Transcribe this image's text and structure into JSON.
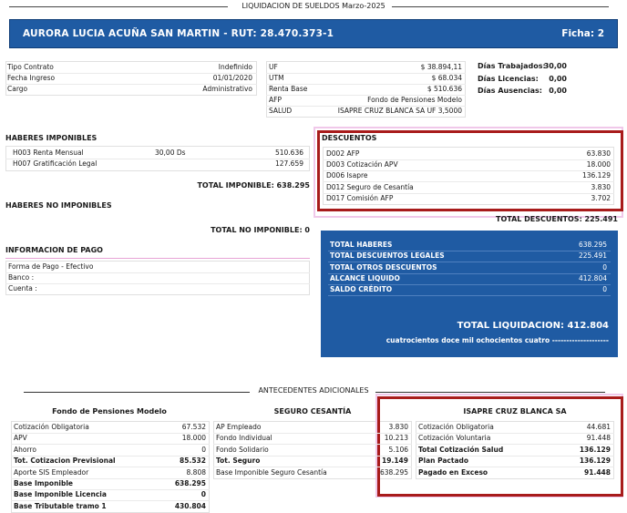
{
  "header": {
    "title": "LIQUIDACION DE SUELDOS Marzo-2025",
    "employee": "AURORA LUCIA ACUÑA SAN MARTIN - RUT: 28.470.373-1",
    "ficha": "Ficha: 2"
  },
  "info_left": [
    {
      "label": "Tipo Contrato",
      "value": "Indefinido"
    },
    {
      "label": "Fecha Ingreso",
      "value": "01/01/2020"
    },
    {
      "label": "Cargo",
      "value": "Administrativo"
    }
  ],
  "info_mid": [
    {
      "label": "UF",
      "value": "$ 38.894,11"
    },
    {
      "label": "UTM",
      "value": "$ 68.034"
    },
    {
      "label": "Renta Base",
      "value": "$ 510.636"
    },
    {
      "label": "AFP",
      "value": "Fondo de Pensiones Modelo"
    },
    {
      "label": "SALUD",
      "value": "ISAPRE CRUZ BLANCA SA UF 3,5000"
    }
  ],
  "days": [
    {
      "label": "Días Trabajados:",
      "value": "30,00"
    },
    {
      "label": "Días Licencias:",
      "value": "0,00"
    },
    {
      "label": "Días Ausencias:",
      "value": "0,00"
    }
  ],
  "haberes_imponibles": {
    "title": "HABERES IMPONIBLES",
    "items": [
      {
        "code": "H003 Renta Mensual",
        "qty": "30,00 Ds",
        "value": "510.636"
      },
      {
        "code": "H007 Gratificación Legal",
        "qty": "",
        "value": "127.659"
      }
    ],
    "total": "TOTAL IMPONIBLE: 638.295"
  },
  "haberes_no_imponibles": {
    "title": "HABERES NO IMPONIBLES",
    "total": "TOTAL NO IMPONIBLE: 0"
  },
  "pago": {
    "title": "INFORMACION DE PAGO",
    "rows": [
      "Forma de Pago - Efectivo",
      "Banco :",
      "Cuenta :"
    ]
  },
  "descuentos": {
    "title": "DESCUENTOS",
    "items": [
      {
        "label": "D002 AFP",
        "value": "63.830"
      },
      {
        "label": "D003 Cotización APV",
        "value": "18.000"
      },
      {
        "label": "D006 Isapre",
        "value": "136.129"
      },
      {
        "label": "D012 Seguro de Cesantía",
        "value": "3.830"
      },
      {
        "label": "D017 Comisión AFP",
        "value": "3.702"
      }
    ],
    "total": "TOTAL DESCUENTOS: 225.491"
  },
  "summary": {
    "rows": [
      {
        "label": "TOTAL HABERES",
        "value": "638.295"
      },
      {
        "label": "TOTAL DESCUENTOS LEGALES",
        "value": "225.491"
      },
      {
        "label": "TOTAL OTROS DESCUENTOS",
        "value": "0"
      },
      {
        "label": "ALCANCE LIQUIDO",
        "value": "412.804"
      },
      {
        "label": "SALDO CRÉDITO",
        "value": "0"
      }
    ],
    "total": "TOTAL LIQUIDACION: 412.804",
    "words": "cuatrocientos doce mil ochocientos cuatro --------------------"
  },
  "antecedentes": {
    "title": "ANTECEDENTES ADICIONALES",
    "afp": {
      "title": "Fondo de Pensiones Modelo",
      "rows": [
        {
          "label": "Cotización Obligatoria",
          "value": "67.532",
          "bold": false
        },
        {
          "label": "APV",
          "value": "18.000",
          "bold": false
        },
        {
          "label": "Ahorro",
          "value": "0",
          "bold": false
        },
        {
          "label": "Tot. Cotizacion Previsional",
          "value": "85.532",
          "bold": true
        },
        {
          "label": "Aporte SIS Empleador",
          "value": "8.808",
          "bold": false
        },
        {
          "label": "Base Imponible",
          "value": "638.295",
          "bold": true
        },
        {
          "label": "Base Imponible Licencia",
          "value": "0",
          "bold": true
        },
        {
          "label": "Base Tributable tramo 1",
          "value": "430.804",
          "bold": true
        }
      ]
    },
    "cesantia": {
      "title": "SEGURO CESANTÍA",
      "rows": [
        {
          "label": "AP Empleado",
          "value": "3.830",
          "bold": false
        },
        {
          "label": "Fondo Individual",
          "value": "10.213",
          "bold": false
        },
        {
          "label": "Fondo Solidario",
          "value": "5.106",
          "bold": false
        },
        {
          "label": "Tot. Seguro",
          "value": "19.149",
          "bold": true
        },
        {
          "label": "Base Imponible Seguro Cesantía",
          "value": "638.295",
          "bold": false
        }
      ]
    },
    "isapre": {
      "title": "ISAPRE CRUZ BLANCA SA",
      "rows": [
        {
          "label": "Cotización Obligatoria",
          "value": "44.681",
          "bold": false
        },
        {
          "label": "Cotización Voluntaria",
          "value": "91.448",
          "bold": false
        },
        {
          "label": "Total Cotización Salud",
          "value": "136.129",
          "bold": true
        },
        {
          "label": "Plan Pactado",
          "value": "136.129",
          "bold": true
        },
        {
          "label": "Pagado en Exceso",
          "value": "91.448",
          "bold": true
        }
      ]
    }
  },
  "colors": {
    "primary": "#1f5ba3",
    "highlight": "#a81b1b"
  }
}
